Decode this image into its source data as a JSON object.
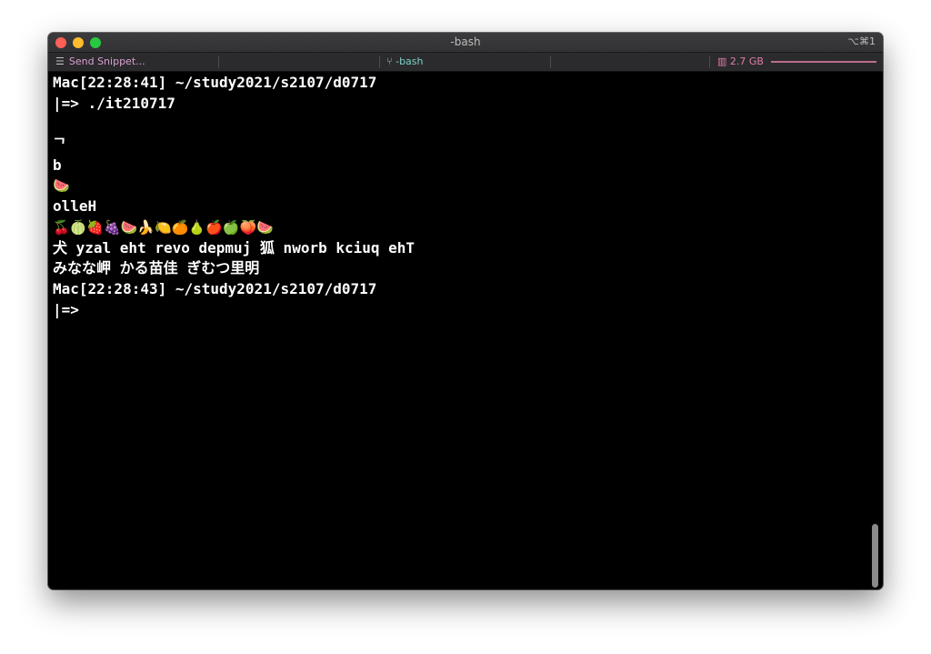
{
  "window": {
    "title": "-bash",
    "shortcut": "⌥⌘1"
  },
  "statusbar": {
    "send_snippet": "Send Snippet...",
    "job": "-bash",
    "memory": "2.7 GB"
  },
  "terminal": {
    "lines": [
      "Mac[22:28:41] ~/study2021/s2107/d0717",
      "|=> ./it210717",
      "",
      "ᄀ",
      "b",
      "🍉",
      "olleH",
      "🍒🍈🍓🍇🍉🍌🍋🍊🍐🍎🍏🍑🍉",
      "犬 yzal eht revo depmuj 狐 nworb kciuq ehT",
      "みなな岬 かる苗佳 ぎむつ里明",
      "Mac[22:28:43] ~/study2021/s2107/d0717",
      "|=>"
    ]
  },
  "colors": {
    "terminal_bg": "#000000",
    "text": "#ffffff",
    "close": "#ff5f57",
    "minimize": "#febc2e",
    "maximize": "#28c840",
    "snippet": "#d6a0d0",
    "job": "#7fd1c8",
    "memory": "#e07da8"
  }
}
